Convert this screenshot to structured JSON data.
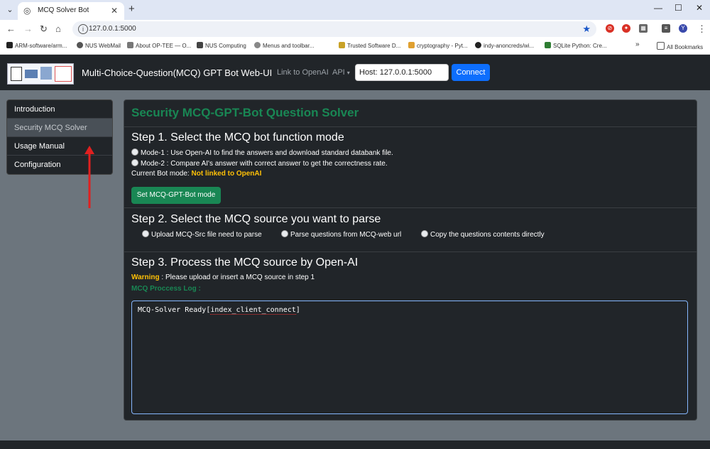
{
  "browser": {
    "tab_title": "MCQ Solver Bot",
    "url": "127.0.0.1:5000",
    "profile_initial": "Y",
    "bookmarks": [
      "ARM-software/arm...",
      "NUS WebMail",
      "About OP-TEE — O...",
      "NUS Computing",
      "Menus and toolbar...",
      "Trusted Software D...",
      "cryptography - Pyt...",
      "indy-anoncreds/wi...",
      "SQLite Python: Cre..."
    ],
    "all_bookmarks_label": "All Bookmarks"
  },
  "app": {
    "brand_title": "Multi-Choice-Question(MCQ) GPT Bot Web-UI",
    "nav_link_openai": "Link to OpenAI",
    "nav_api": "API",
    "host_value": "Host: 127.0.0.1:5000",
    "connect_label": "Connect"
  },
  "sidebar": {
    "items": [
      {
        "label": "Introduction"
      },
      {
        "label": "Security MCQ Solver"
      },
      {
        "label": "Usage Manual"
      },
      {
        "label": "Configuration"
      }
    ],
    "active_index": 1
  },
  "panel": {
    "title": "Security MCQ-GPT-Bot Question Solver",
    "step1": {
      "heading": "Step 1. Select the MCQ bot function mode",
      "mode1": "Mode-1 : Use Open-AI to find the answers and download standard databank file.",
      "mode2": "Mode-2 : Compare AI's answer with correct answer to get the correctness rate.",
      "current_mode_label": "Current Bot mode:",
      "current_mode_value": "Not linked to OpenAI",
      "set_mode_button": "Set MCQ-GPT-Bot mode"
    },
    "step2": {
      "heading": "Step 2. Select the MCQ source you want to parse",
      "options": [
        "Upload MCQ-Src file need to parse",
        "Parse questions from MCQ-web url",
        "Copy the questions contents directly"
      ]
    },
    "step3": {
      "heading": "Step 3. Process the MCQ source by Open-AI",
      "warning_label": "Warning",
      "warning_text": " : Please upload or insert a MCQ source in step 1",
      "log_label": "MCQ Proccess Log :",
      "log_prefix": "MCQ-Solver Ready[",
      "log_tag": "index_client_connect",
      "log_suffix": "]"
    }
  },
  "colors": {
    "accent_green": "#198754",
    "primary_blue": "#0d6efd",
    "warning_yellow": "#ffc107",
    "annotation_arrow": "#e02020"
  }
}
